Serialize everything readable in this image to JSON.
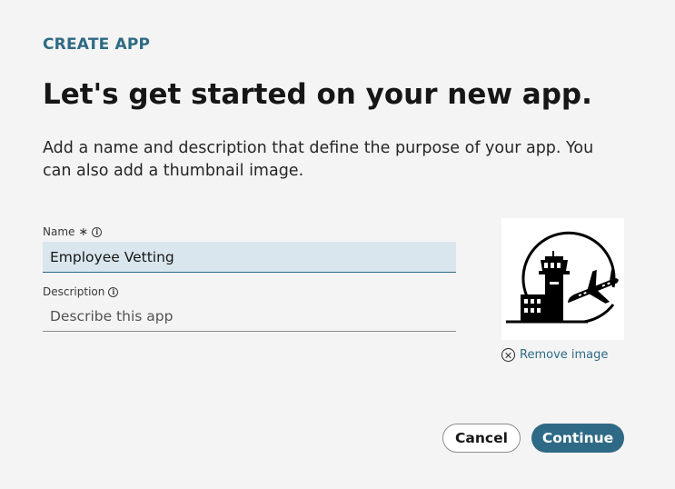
{
  "header": {
    "eyebrow": "CREATE APP",
    "title": "Let's get started on your new app.",
    "description": "Add a name and description that define the purpose of your app. You can also add a thumbnail image."
  },
  "form": {
    "name_label": "Name",
    "name_required_marker": "∗",
    "name_value": "Employee Vetting",
    "description_label": "Description",
    "description_placeholder": "Describe this app"
  },
  "thumbnail": {
    "icon": "airport-tower-airplane-icon",
    "remove_label": "Remove image"
  },
  "actions": {
    "cancel_label": "Cancel",
    "continue_label": "Continue"
  },
  "colors": {
    "accent": "#2e6a85",
    "background": "#f4f4f4",
    "input_fill": "#d9e6ed"
  }
}
